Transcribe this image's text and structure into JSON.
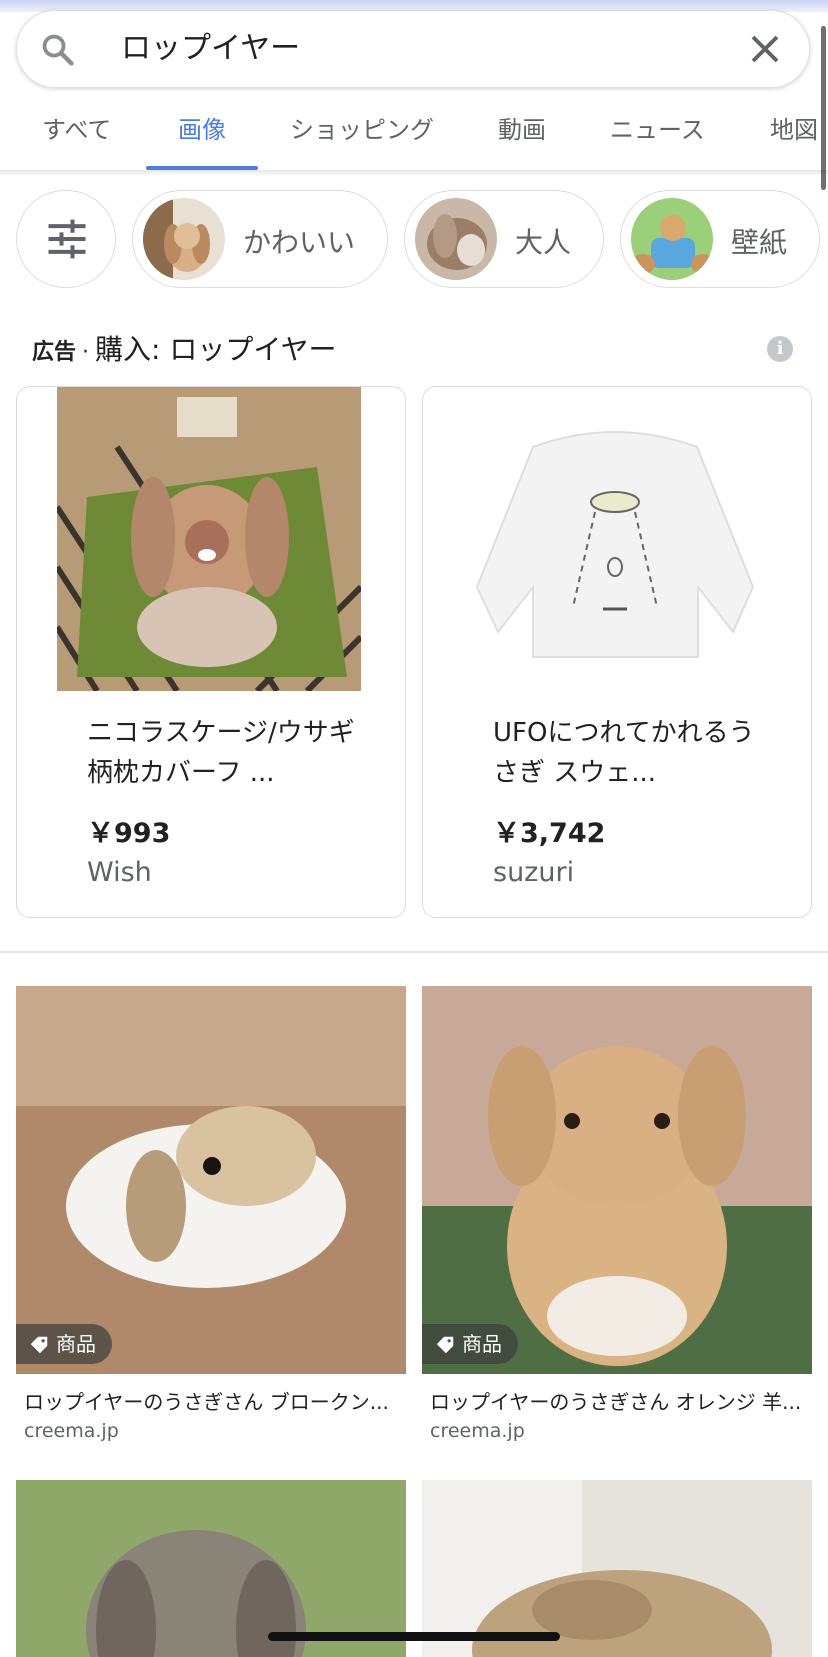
{
  "search": {
    "query": "ロップイヤー",
    "search_icon": "search-icon",
    "clear_icon": "close-icon"
  },
  "tabs": [
    {
      "label": "すべて",
      "active": false
    },
    {
      "label": "画像",
      "active": true
    },
    {
      "label": "ショッピング",
      "active": false
    },
    {
      "label": "動画",
      "active": false
    },
    {
      "label": "ニュース",
      "active": false
    },
    {
      "label": "地図",
      "active": false
    }
  ],
  "chips": {
    "filter_icon": "tune-icon",
    "items": [
      {
        "label": "かわいい"
      },
      {
        "label": "大人"
      },
      {
        "label": "壁紙"
      }
    ]
  },
  "ads": {
    "ad_label": "広告",
    "separator": "·",
    "title": "購入: ロップイヤー",
    "info_icon": "info-icon",
    "products": [
      {
        "title": "ニコラスケージ/ウサギ柄枕カバーフ ...",
        "price": "￥993",
        "store": "Wish"
      },
      {
        "title": "UFOにつれてかれるうさぎ スウェ...",
        "price": "￥3,742",
        "store": "suzuri"
      }
    ]
  },
  "results": [
    {
      "badge": "商品",
      "title": "ロップイヤーのうさぎさん ブロークン...",
      "site": "creema.jp"
    },
    {
      "badge": "商品",
      "title": "ロップイヤーのうさぎさん オレンジ 羊...",
      "site": "creema.jp"
    }
  ],
  "colors": {
    "accent": "#4a7de0",
    "text": "#202124",
    "muted": "#5f6368",
    "border": "#dadce0"
  }
}
